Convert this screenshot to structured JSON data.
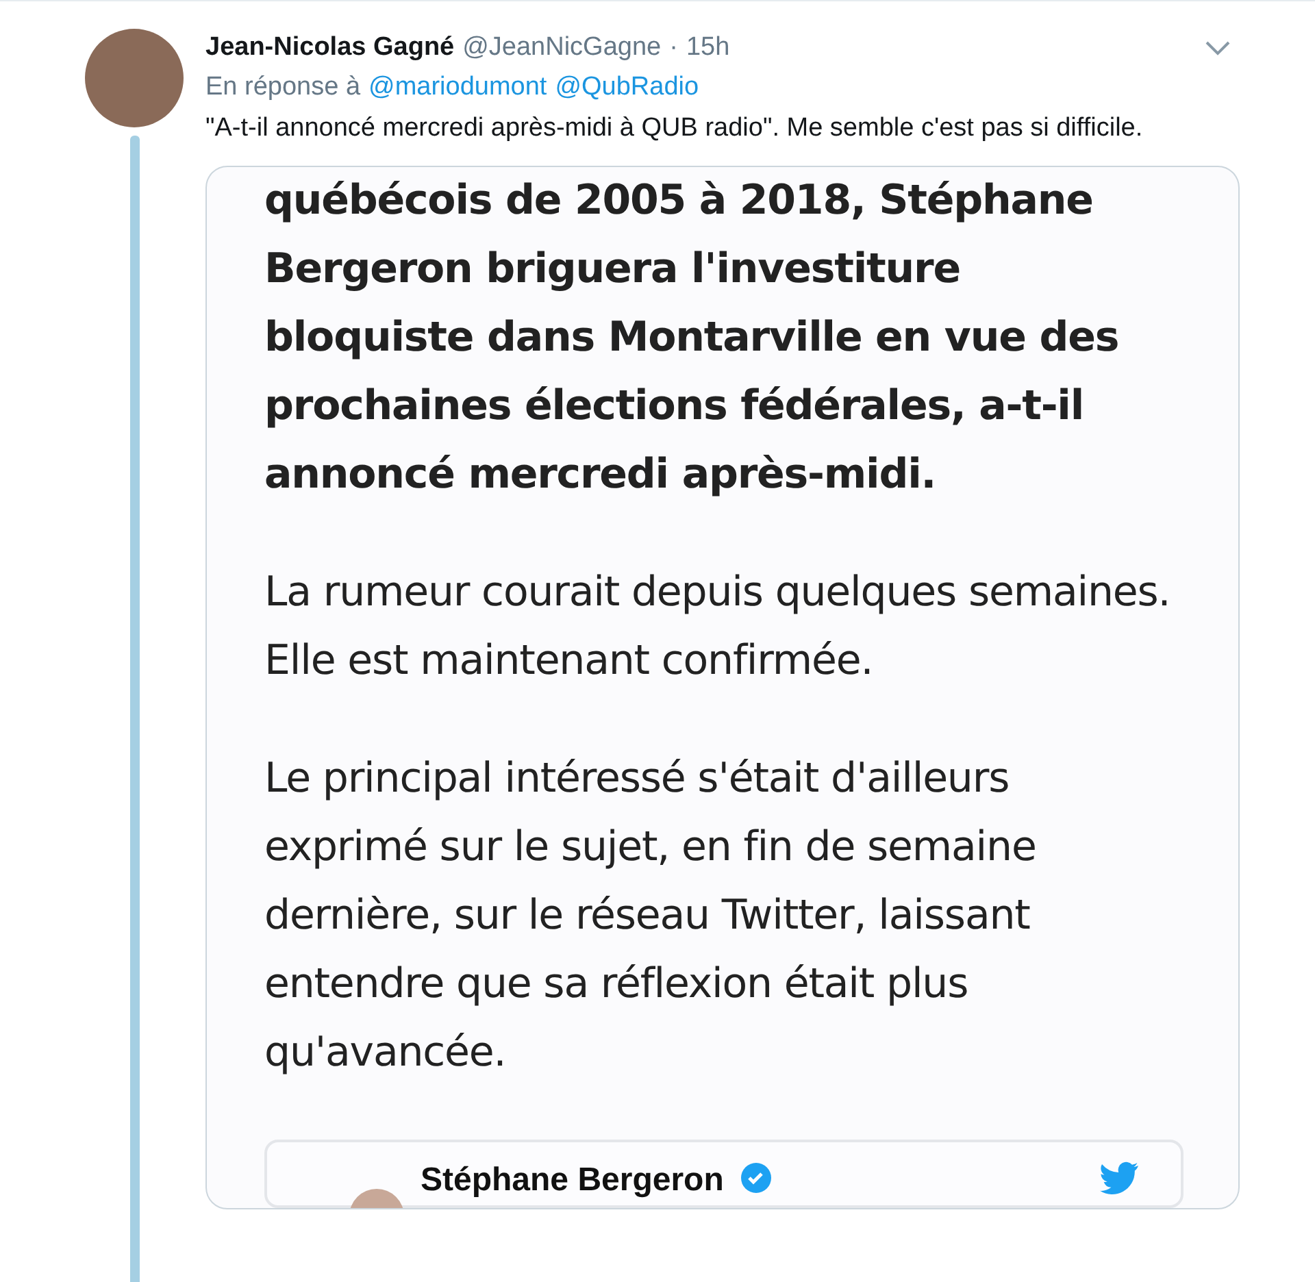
{
  "tweet": {
    "author": "Jean-Nicolas Gagné",
    "handle": "@JeanNicGagne",
    "separator": "·",
    "time": "15h",
    "reply_prefix": "En réponse à",
    "reply_to": [
      "@mariodumont",
      "@QubRadio"
    ],
    "text": "\"A-t-il annoncé mercredi après-midi à QUB radio\". Me semble c'est pas si difficile."
  },
  "article_image": {
    "paragraphs": [
      {
        "kind": "lead",
        "text": "québécois de 2005 à 2018, Stéphane Bergeron briguera l'investiture bloquiste dans Montarville en vue des prochaines élections fédérales, a-t-il annoncé mercredi après-midi."
      },
      {
        "kind": "body",
        "text": "La rumeur courait depuis quelques semaines. Elle est maintenant confirmée."
      },
      {
        "kind": "body",
        "text": "Le principal intéressé s'était d'ailleurs exprimé sur le sujet, en fin de semaine dernière, sur le réseau Twitter, laissant entendre que sa réflexion était plus qu'avancée."
      }
    ],
    "embedded_tweet": {
      "author": "Stéphane Bergeron"
    }
  }
}
